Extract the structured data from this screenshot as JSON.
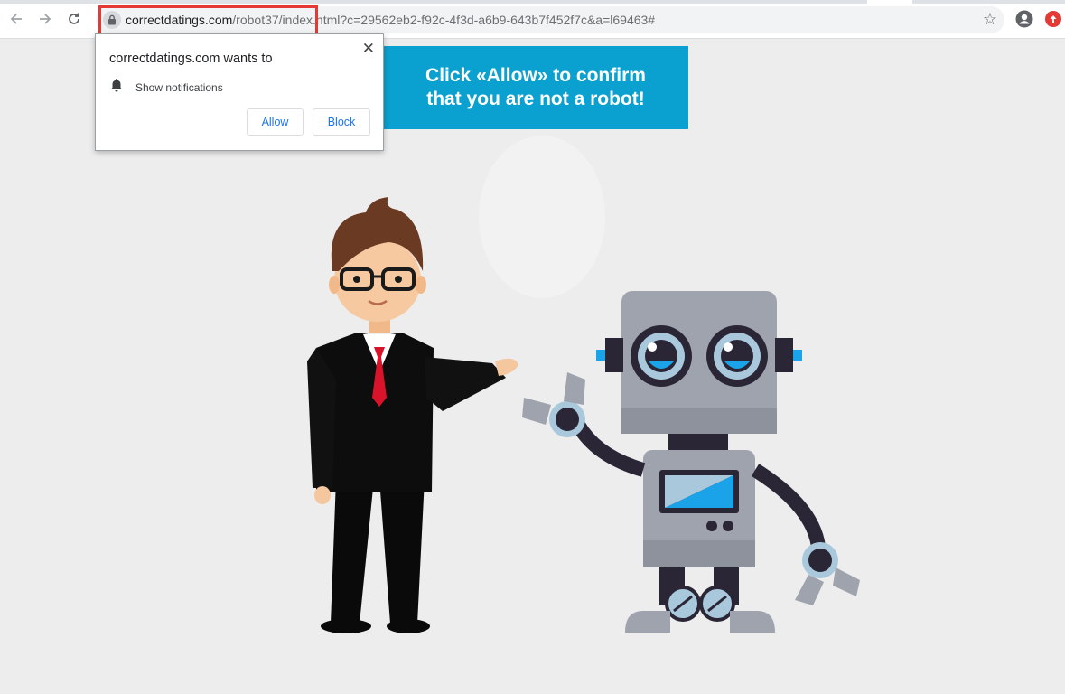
{
  "browser": {
    "url_domain": "correctdatings.com",
    "url_rest": "/robot37/index.html?c=29562eb2-f92c-4f3d-a6b9-643b7f452f7c&a=l69463#",
    "icons": {
      "back": "back-arrow-icon",
      "forward": "forward-arrow-icon",
      "reload": "reload-icon",
      "lock": "lock-icon",
      "bookmark": "star-icon",
      "profile": "account-icon",
      "extension": "extension-icon"
    }
  },
  "popup": {
    "title": "correctdatings.com wants to",
    "permission": "Show notifications",
    "allow_label": "Allow",
    "block_label": "Block",
    "close_glyph": "✕"
  },
  "banner": {
    "line1": "Click «Allow» to confirm",
    "line2": "that you are not a robot!",
    "color": "#0aa0d0"
  },
  "colors": {
    "highlight": "#e53935",
    "page_bg": "#ededed"
  }
}
